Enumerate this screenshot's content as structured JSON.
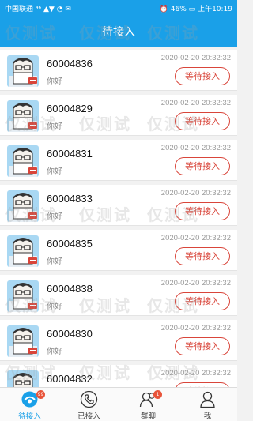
{
  "status_bar": {
    "carrier": "中国联通",
    "signal": "⁴⁶ ▲▼",
    "wifi_glyph": "✉",
    "battery": "46%",
    "time": "上午10:19"
  },
  "header": {
    "title": "待接入"
  },
  "watermark": {
    "text": "仅测试"
  },
  "rows": [
    {
      "id": "60004836",
      "msg": "你好",
      "time": "2020-02-20 20:32:32",
      "action": "等待接入"
    },
    {
      "id": "60004829",
      "msg": "你好",
      "time": "2020-02-20 20:32:32",
      "action": "等待接入"
    },
    {
      "id": "60004831",
      "msg": "你好",
      "time": "2020-02-20 20:32:32",
      "action": "等待接入"
    },
    {
      "id": "60004833",
      "msg": "你好",
      "time": "2020-02-20 20:32:32",
      "action": "等待接入"
    },
    {
      "id": "60004835",
      "msg": "你好",
      "time": "2020-02-20 20:32:32",
      "action": "等待接入"
    },
    {
      "id": "60004838",
      "msg": "你好",
      "time": "2020-02-20 20:32:32",
      "action": "等待接入"
    },
    {
      "id": "60004830",
      "msg": "你好",
      "time": "2020-02-20 20:32:32",
      "action": "等待接入"
    },
    {
      "id": "60004832",
      "msg": "你好",
      "time": "2020-02-20 20:32:32",
      "action": "等待接入"
    }
  ],
  "tabs": [
    {
      "label": "待接入",
      "icon": "waiting-icon",
      "active": true,
      "badge": "99"
    },
    {
      "label": "已接入",
      "icon": "phone-icon",
      "active": false
    },
    {
      "label": "群聊",
      "icon": "group-icon",
      "active": false,
      "badge": "1"
    },
    {
      "label": "我",
      "icon": "user-icon",
      "active": false
    }
  ],
  "colors": {
    "primary": "#1aa0e8",
    "accent": "#d9453a"
  }
}
